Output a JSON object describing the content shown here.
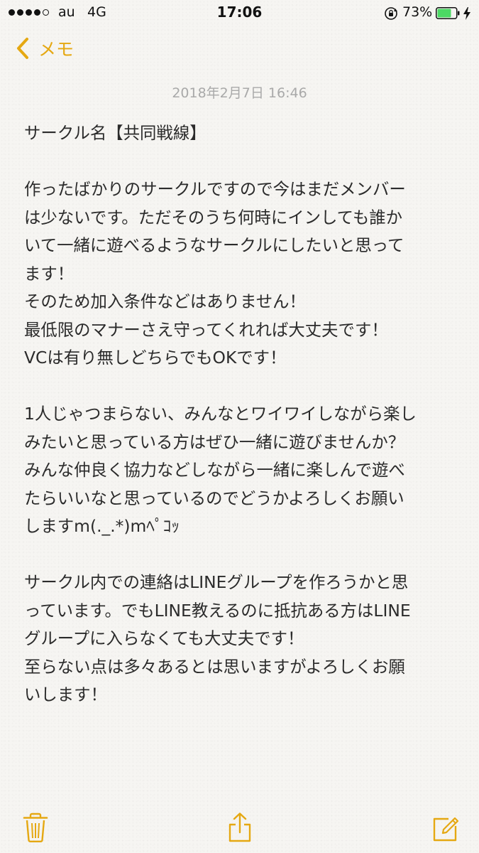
{
  "status_bar": {
    "carrier": "au",
    "network": "4G",
    "time": "17:06",
    "battery_percent": "73%",
    "battery_level": 0.73,
    "signal_bars": 4,
    "icons": [
      "signal-dots",
      "orientation-lock-icon",
      "battery-icon",
      "charging-icon"
    ]
  },
  "nav": {
    "back_label": "メモ",
    "back_icon": "chevron-left-icon"
  },
  "note": {
    "date": "2018年2月7日 16:46",
    "lines": [
      "サークル名【共同戦線】",
      "",
      "作ったばかりのサークルですので今はまだメンバー",
      "は少ないです。ただそのうち何時にインしても誰か",
      "いて一緒に遊べるようなサークルにしたいと思って",
      "ます！",
      "そのため加入条件などはありません！",
      "最低限のマナーさえ守ってくれれば大丈夫です！",
      "VCは有り無しどちらでもOKです！",
      "",
      "1人じゃつまらない、みんなとワイワイしながら楽し",
      "みたいと思っている方はぜひ一緒に遊びませんか？",
      "みんな仲良く協力などしながら一緒に楽しんで遊べ",
      "たらいいなと思っているのでどうかよろしくお願い",
      "しますm(._.*)mﾍﾟｺｯ",
      "",
      "サークル内での連絡はLINEグループを作ろうかと思",
      "っています。でもLINE教えるのに抵抗ある方はLINE",
      "グループに入らなくても大丈夫です！",
      "至らない点は多々あるとは思いますがよろしくお願",
      "いします！"
    ]
  },
  "toolbar": {
    "icons": [
      "trash-icon",
      "share-icon",
      "compose-icon"
    ]
  },
  "colors": {
    "accent": "#e5a812",
    "background": "#f6f5f2",
    "text": "#2b2b2b",
    "date_text": "#a9a9a9",
    "battery_fill": "#4cd964"
  }
}
